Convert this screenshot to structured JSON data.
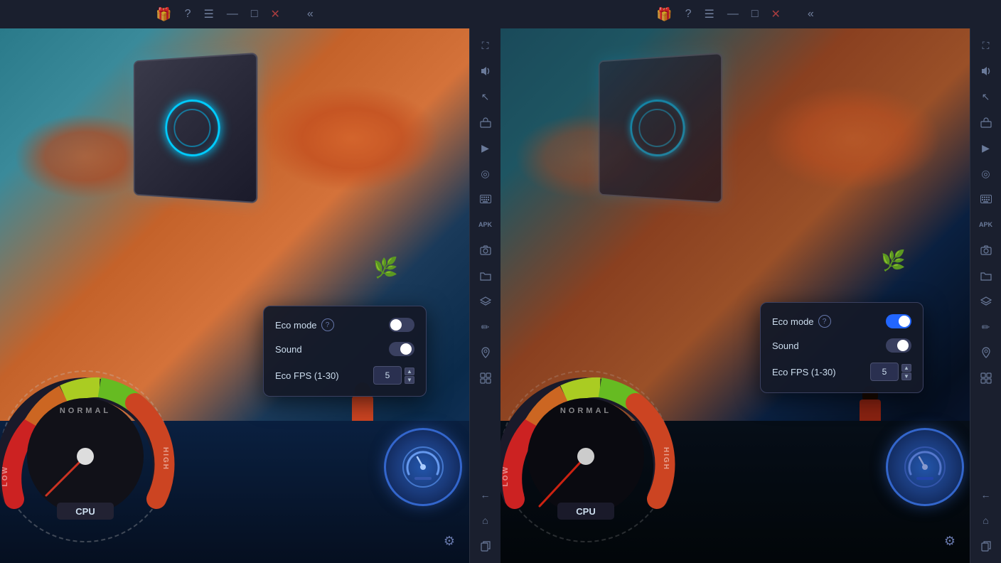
{
  "titlebar": {
    "gift_icon": "🎁",
    "help_icon": "?",
    "menu_icon": "☰",
    "minimize_icon": "—",
    "maximize_icon": "□",
    "close_icon": "✕",
    "back_icon": "«"
  },
  "left_panel": {
    "eco_popup": {
      "eco_mode_label": "Eco mode",
      "eco_mode_toggle": "off",
      "sound_label": "Sound",
      "sound_toggle": "off",
      "fps_label": "Eco FPS (1-30)",
      "fps_value": "5",
      "info_icon": "?"
    },
    "cpu_label": "CPU",
    "normal_label": "NORMAL",
    "low_label": "LOW",
    "high_label": "HIGH"
  },
  "right_panel": {
    "eco_popup": {
      "eco_mode_label": "Eco mode",
      "eco_mode_toggle": "on",
      "sound_label": "Sound",
      "sound_toggle": "off",
      "fps_label": "Eco FPS (1-30)",
      "fps_value": "5",
      "info_icon": "?"
    },
    "cpu_label": "CPU",
    "normal_label": "NORMAL",
    "low_label": "LOW",
    "high_label": "HIGH"
  },
  "sidebar_icons": {
    "fullscreen": "⛶",
    "volume": "🔊",
    "cursor": "↖",
    "toolbox": "🧰",
    "play": "▶",
    "target": "◎",
    "keyboard": "⌨",
    "apk": "APK",
    "camera": "📷",
    "folder": "📁",
    "layers": "⧉",
    "brush": "✏",
    "location": "📍",
    "stack": "⊞",
    "back": "←",
    "home": "⌂",
    "copy": "⧉"
  }
}
